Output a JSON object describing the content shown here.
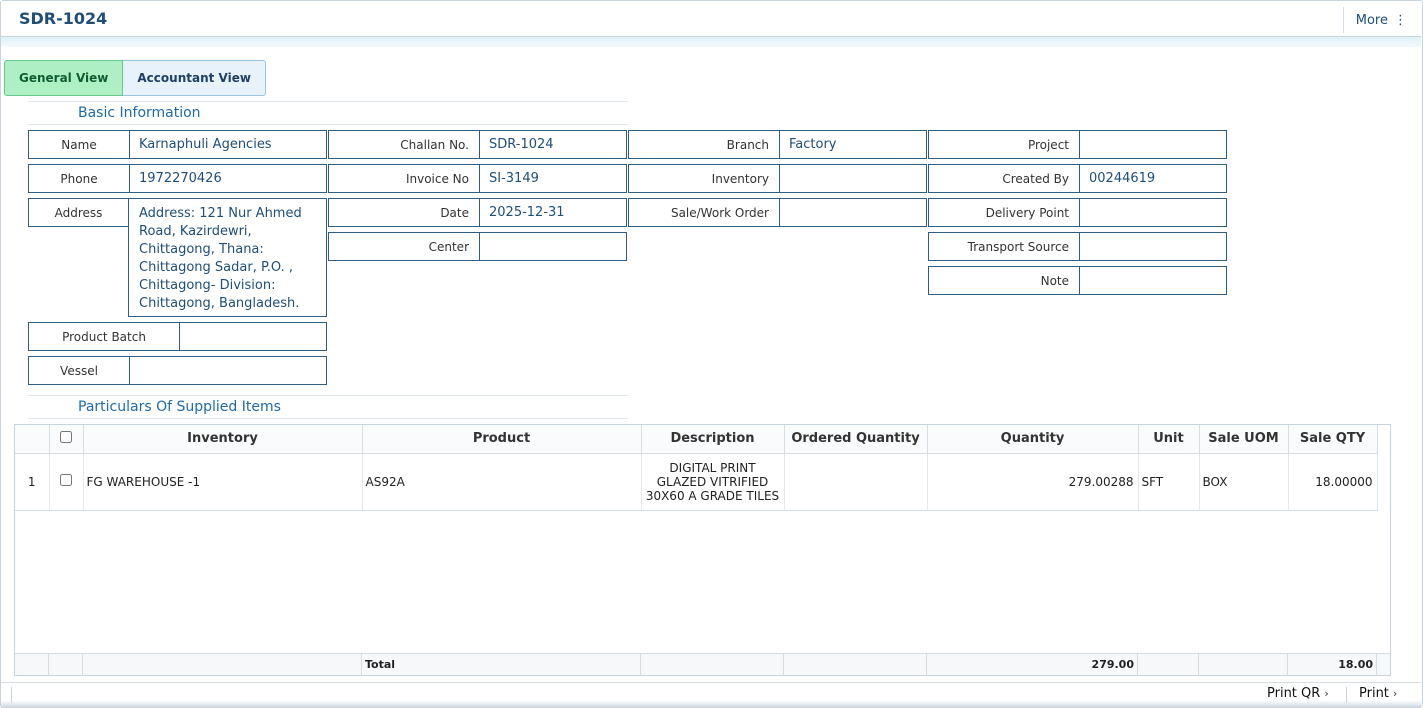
{
  "header": {
    "title": "SDR-1024",
    "more_label": "More",
    "more_icon": "⋮"
  },
  "tabs": [
    {
      "label": "General View",
      "active": true
    },
    {
      "label": "Accountant View",
      "active": false
    }
  ],
  "sections": {
    "basic": "Basic Information",
    "particulars": "Particulars Of Supplied Items"
  },
  "fields": {
    "name": {
      "label": "Name",
      "value": "Karnaphuli Agencies"
    },
    "phone": {
      "label": "Phone",
      "value": "1972270426"
    },
    "address": {
      "label": "Address",
      "value": "Address: 121 Nur Ahmed Road, Kazirdewri, Chittagong, Thana: Chittagong Sadar, P.O. , Chittagong- Division: Chittagong, Bangladesh."
    },
    "product_batch": {
      "label": "Product Batch",
      "value": ""
    },
    "vessel": {
      "label": "Vessel",
      "value": ""
    },
    "challan": {
      "label": "Challan No.",
      "value": "SDR-1024"
    },
    "invoice": {
      "label": "Invoice No",
      "value": "SI-3149"
    },
    "date": {
      "label": "Date",
      "value": "2025-12-31"
    },
    "center": {
      "label": "Center",
      "value": ""
    },
    "branch": {
      "label": "Branch",
      "value": "Factory"
    },
    "inventory": {
      "label": "Inventory",
      "value": ""
    },
    "sale_work_order": {
      "label": "Sale/Work Order",
      "value": ""
    },
    "project": {
      "label": "Project",
      "value": ""
    },
    "created_by": {
      "label": "Created By",
      "value": "00244619"
    },
    "delivery_point": {
      "label": "Delivery Point",
      "value": ""
    },
    "transport_source": {
      "label": "Transport Source",
      "value": ""
    },
    "note": {
      "label": "Note",
      "value": ""
    }
  },
  "table": {
    "columns": [
      "Inventory",
      "Product",
      "Description",
      "Ordered Quantity",
      "Quantity",
      "Unit",
      "Sale UOM",
      "Sale QTY"
    ],
    "rows": [
      {
        "index": "1",
        "inventory": "FG WAREHOUSE -1",
        "product": "AS92A",
        "description": "DIGITAL PRINT GLAZED VITRIFIED 30X60 A GRADE TILES",
        "ordered_quantity": "",
        "quantity": "279.00288",
        "unit": "SFT",
        "sale_uom": "BOX",
        "sale_qty": "18.00000"
      }
    ],
    "totals": {
      "label": "Total",
      "quantity": "279.00",
      "sale_qty": "18.00"
    }
  },
  "footer": {
    "print_qr": "Print QR",
    "print": "Print",
    "chevron": "›"
  }
}
